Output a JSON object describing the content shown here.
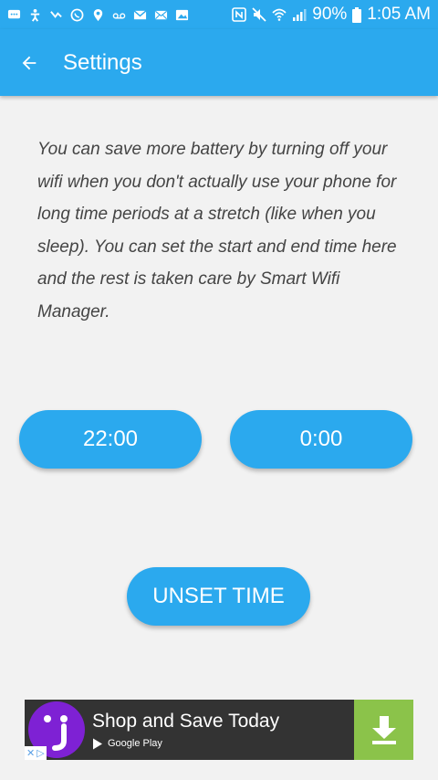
{
  "status_bar": {
    "battery_percent": "90%",
    "time": "1:05 AM",
    "left_icons": [
      "messages-icon",
      "accessibility-icon",
      "missed-call-icon",
      "whatsapp-icon",
      "location-icon",
      "voicemail-icon",
      "gmail-icon",
      "email-icon",
      "photo-icon"
    ],
    "right_icons": [
      "nfc-icon",
      "mute-icon",
      "wifi-icon",
      "signal-icon",
      "battery-icon"
    ]
  },
  "app_bar": {
    "title": "Settings"
  },
  "description": "You can save more battery by turning off your wifi when you don't actually use your phone for long time periods at a stretch (like when you sleep). You can set the start and end time here and the rest is taken care by Smart Wifi Manager.",
  "times": {
    "start": "22:00",
    "end": "0:00"
  },
  "unset_label": "UNSET TIME",
  "ad": {
    "title": "Shop and Save Today",
    "store": "Google Play"
  },
  "colors": {
    "primary": "#2ba9ee",
    "background": "#f2f2f2",
    "ad_background": "#333333",
    "ad_download": "#8bc34a",
    "ad_logo": "#7e21d4"
  }
}
